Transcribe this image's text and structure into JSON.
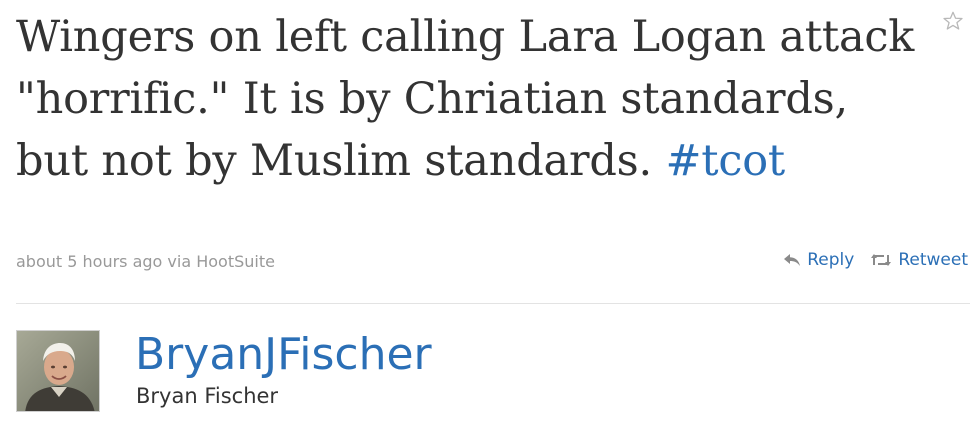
{
  "tweet": {
    "text": "Wingers on left calling Lara Logan attack \"horrific.\" It is by Chriatian standards, but not by Muslim standards. ",
    "hashtag": "#tcot",
    "timestamp": "about 5 hours ago via HootSuite"
  },
  "actions": {
    "reply_label": "Reply",
    "retweet_label": "Retweet",
    "favorite_icon": "star-icon",
    "reply_icon": "reply-arrow-icon",
    "retweet_icon": "retweet-icon"
  },
  "author": {
    "screen_name": "BryanJFischer",
    "full_name": "Bryan Fischer"
  },
  "colors": {
    "link": "#2b6fb6",
    "text": "#333333",
    "meta": "#999999",
    "divider": "#e3e3e3"
  }
}
